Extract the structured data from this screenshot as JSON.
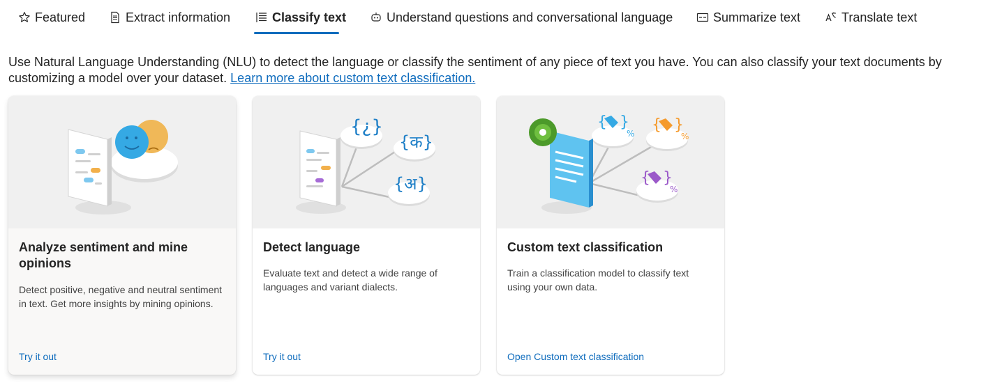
{
  "tabs": [
    {
      "label": "Featured",
      "icon": "star-icon"
    },
    {
      "label": "Extract information",
      "icon": "document-icon"
    },
    {
      "label": "Classify text",
      "icon": "list-icon",
      "active": true
    },
    {
      "label": "Understand questions and conversational language",
      "icon": "bot-icon"
    },
    {
      "label": "Summarize text",
      "icon": "text-box-icon"
    },
    {
      "label": "Translate text",
      "icon": "translate-icon"
    }
  ],
  "description": {
    "text": "Use Natural Language Understanding (NLU) to detect the language or classify the sentiment of any piece of text you have. You can also classify your text documents by customizing a model over your dataset.",
    "link": "Learn more about custom text classification."
  },
  "cards": [
    {
      "title": "Analyze sentiment and mine opinions",
      "body": "Detect positive, negative and neutral sentiment in text. Get more insights by mining opinions.",
      "action": "Try it out"
    },
    {
      "title": "Detect language",
      "body": "Evaluate text and detect a wide range of languages and variant dialects.",
      "action": "Try it out"
    },
    {
      "title": "Custom text classification",
      "body": "Train a classification model to classify text using your own data.",
      "action": "Open Custom text classification"
    }
  ],
  "colors": {
    "accent": "#0f6cbd",
    "text": "#242424",
    "muted": "#424242"
  }
}
